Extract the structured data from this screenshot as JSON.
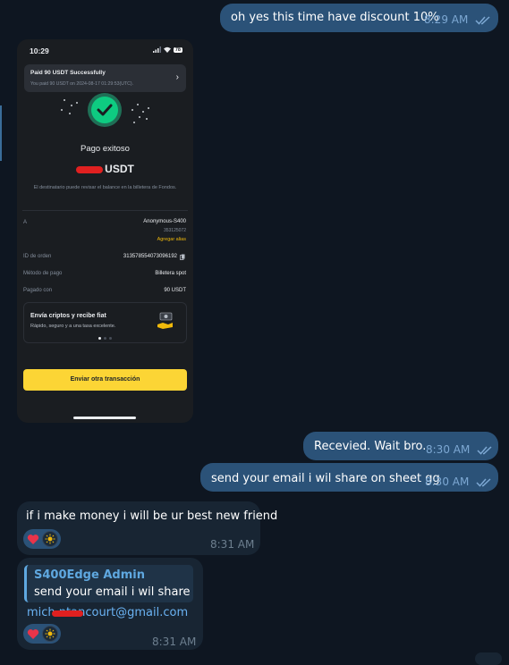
{
  "messages": [
    {
      "id": "m1",
      "direction": "outgoing",
      "text": "oh yes this time have discount 10%",
      "time": "8:29 AM",
      "status": "read"
    },
    {
      "id": "m2",
      "direction": "outgoing",
      "text": "Recevied. Wait bro.",
      "time": "8:30 AM",
      "status": "read"
    },
    {
      "id": "m3",
      "direction": "outgoing",
      "text": "send your email i wil share on sheet gg",
      "time": "8:30 AM",
      "status": "read"
    },
    {
      "id": "m4",
      "direction": "incoming",
      "text": "if i make money i will be ur best new friend",
      "time": "8:31 AM",
      "reactions": [
        "heart",
        "avatar"
      ]
    },
    {
      "id": "m5",
      "direction": "incoming",
      "reply_to": {
        "sender": "S400Edge Admin",
        "text": "send your email i wil share ..."
      },
      "email": "mich    ntancourt@gmail.com",
      "time": "8:31 AM",
      "reactions": [
        "heart",
        "avatar"
      ]
    }
  ],
  "screenshot": {
    "status_time": "10:29",
    "battery": "78",
    "notification": {
      "title": "Paid 90 USDT Successfully",
      "subtitle": "You paid 90 USDT on 2024-08-17 01:29:53(UTC)."
    },
    "heading": "Pago exitoso",
    "amount_suffix": "USDT",
    "note": "El destinatario puede revisar el balance en la billetera de Fondos.",
    "recipient_label": "A",
    "recipient_name": "Anonymous-S400",
    "recipient_id": "353125072",
    "add_alias": "Agregar alias",
    "order_label": "ID de orden",
    "order_value": "313578554073096192",
    "method_label": "Método de pago",
    "method_value": "Billetera spot",
    "paid_label": "Pagado con",
    "paid_value": "90 USDT",
    "promo_title": "Envía criptos y recibe fiat",
    "promo_sub": "Rápido, seguro y a una tasa excelente.",
    "button": "Enviar otra transacción"
  },
  "colors": {
    "background": "#0e1621",
    "outgoing_bubble": "#2b5278",
    "incoming_bubble": "#182533",
    "link": "#6ab2f2",
    "binance_yellow": "#fcd535",
    "success_green": "#0ecb81",
    "redaction": "#e02020"
  }
}
